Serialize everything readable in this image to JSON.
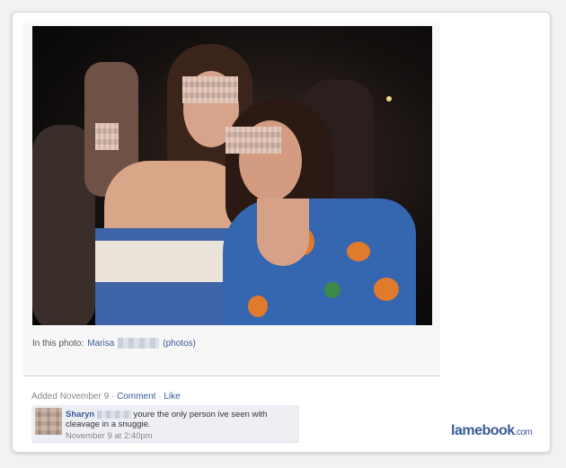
{
  "caption": {
    "prefix": "In this photo:",
    "person_name": "Marisa",
    "photos_link": "(photos)"
  },
  "meta": {
    "added": "Added November 9",
    "separator1": "·",
    "comment_link": "Comment",
    "separator2": "·",
    "like_link": "Like"
  },
  "comment": {
    "author": "Sharyn",
    "text": "youre the only person ive seen with cleavage in a snuggie.",
    "timestamp": "November 9 at 2:40pm"
  },
  "watermark": {
    "brand": "lamebook",
    "suffix": ".com"
  },
  "colors": {
    "link": "#3b5998",
    "comment_bg": "#edeff4"
  }
}
